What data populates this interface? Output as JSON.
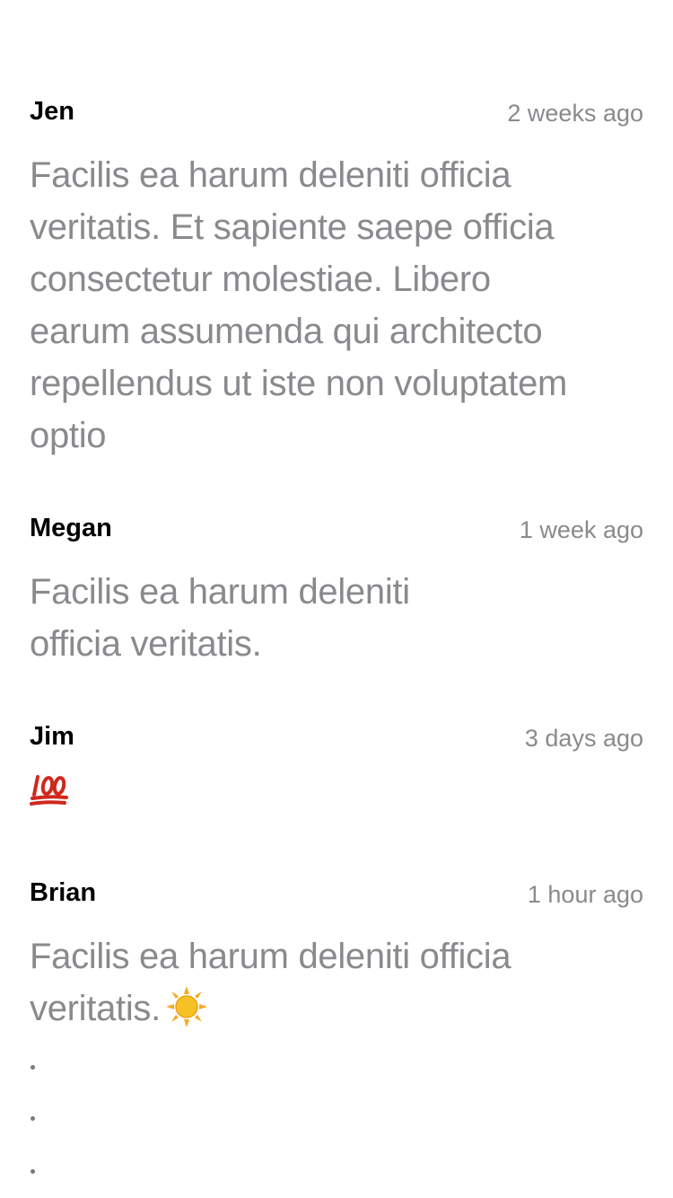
{
  "comments": [
    {
      "author": "Jen",
      "time": "2 weeks ago",
      "lines": [
        "Facilis ea harum deleniti officia",
        "veritatis. Et sapiente saepe officia",
        "consectetur molestiae. Libero",
        "earum assumenda qui architecto",
        "repellendus ut iste non voluptatem",
        "optio"
      ]
    },
    {
      "author": "Megan",
      "time": "1 week ago",
      "lines": [
        "Facilis ea harum deleniti",
        "officia veritatis."
      ]
    },
    {
      "author": "Jim",
      "time": "3 days ago",
      "emoji": "hundred-points-emoji"
    },
    {
      "author": "Brian",
      "time": "1 hour ago",
      "lines": [
        "Facilis ea harum deleniti officia",
        "veritatis."
      ],
      "emoji": "sun-emoji"
    }
  ],
  "colors": {
    "author": "#000000",
    "secondary_text": "#8a8a8e",
    "background": "#ffffff",
    "emoji_red": "#d1281d",
    "sun_yellow": "#f6c125"
  }
}
